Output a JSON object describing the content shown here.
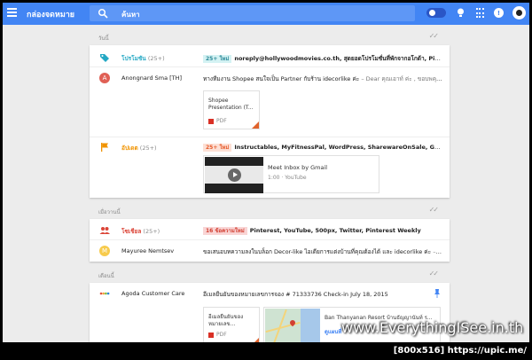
{
  "topbar": {
    "app_title": "กล่องจดหมาย",
    "search_value": "ค้นหา"
  },
  "sections": {
    "today": "วันนี้",
    "yesterday": "เมื่อวานนี้",
    "this_month": "เดือนนี้"
  },
  "card1": {
    "promo": {
      "sender": "โปรโมชัน",
      "count": "(25+)",
      "badge": "25+ ใหม่",
      "snippet": "noreply@hollywoodmovies.co.th, สุดยอดโปรโมชั่นที่พักจากอโกด้า, Pinterest"
    },
    "anongnard": {
      "avatar": "A",
      "sender": "Anongnard Sma [TH]",
      "snippet": "ทางทีมงาน Shopee สนใจเป็น Partner กับร้าน idecorlike ค่ะ",
      "snippet_muted": " – Dear คุณเอาท์ ค่ะ , ขอบพคุณ สำห",
      "attachment_title": "Shopee Presentation (T...",
      "attachment_type": "PDF"
    },
    "updates": {
      "sender": "อัปเดต",
      "count": "(25+)",
      "badge": "25+ ใหม่",
      "snippet": "Instructables, MyFitnessPal, WordPress, Shareware​OnSale, Google, Bret Ta",
      "video_title": "Meet Inbox by Gmail",
      "video_meta": "1:00 · YouTube"
    }
  },
  "card2": {
    "social": {
      "sender": "โซเชียล",
      "count": "(25+)",
      "badge": "16 ข้อความใหม่",
      "snippet": "Pinterest, YouTube, 500px, Twitter, Pinterest Weekly"
    },
    "mayuree": {
      "avatar": "M",
      "sender": "Mayuree Nemtsev",
      "snippet": "ขอเสนอบทความลงในบล็อก Decor-like ไอเดียการแต่งบ้านที่คุณต้องได้ และ idecorlike ค่ะ",
      "snippet_muted": " – สวัสดี"
    }
  },
  "card3": {
    "agoda": {
      "sender": "Agoda Customer Care",
      "snippet": "อีเมลยืนยันของหมายเลขการจอง # 71333736 Check-in July 18, 2015",
      "attachment_title": "อีเมลยืนยันของหมายเลข...",
      "attachment_type": "PDF",
      "map_title": "Ban Thanyanan Resort บ้านธัญญานันท์ ร...",
      "map_link": "ดูแผนที่"
    }
  },
  "watermark": "www.EverythingISee.in.th",
  "footer": "[800x516] https://upic.me/"
}
